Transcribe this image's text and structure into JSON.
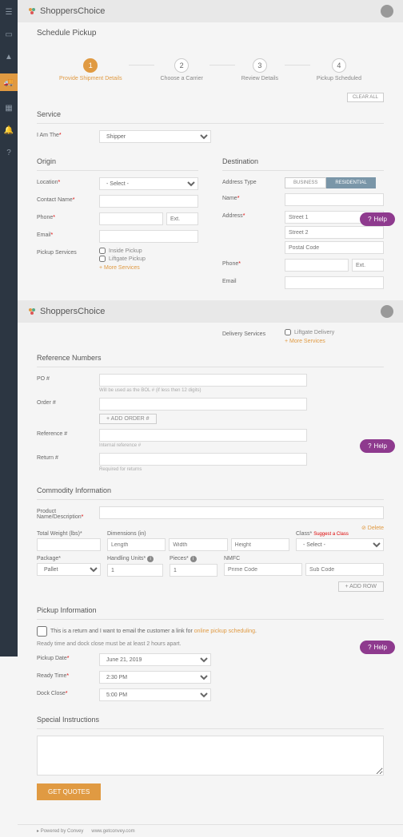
{
  "brand": "ShoppersChoice",
  "page_title": "Schedule Pickup",
  "steps": [
    {
      "num": "1",
      "label": "Provide Shipment Details"
    },
    {
      "num": "2",
      "label": "Choose a Carrier"
    },
    {
      "num": "3",
      "label": "Review Details"
    },
    {
      "num": "4",
      "label": "Pickup Scheduled"
    }
  ],
  "clear_all": "CLEAR ALL",
  "service": {
    "title": "Service",
    "i_am_the": "I Am The",
    "i_am_the_value": "Shipper"
  },
  "origin": {
    "title": "Origin",
    "location": "Location",
    "location_placeholder": "- Select -",
    "contact_name": "Contact Name",
    "phone": "Phone",
    "ext": "Ext.",
    "email": "Email",
    "pickup_services": "Pickup Services",
    "inside_pickup": "Inside Pickup",
    "liftgate_pickup": "Liftgate Pickup",
    "more": "+ More Services"
  },
  "destination": {
    "title": "Destination",
    "address_type": "Address Type",
    "business": "BUSINESS",
    "residential": "RESIDENTIAL",
    "name": "Name",
    "address": "Address",
    "street1": "Street 1",
    "street2": "Street 2",
    "postal": "Postal Code",
    "phone": "Phone",
    "ext": "Ext.",
    "email": "Email",
    "delivery_services": "Delivery Services",
    "liftgate_delivery": "Liftgate Delivery",
    "more": "+ More Services"
  },
  "ref": {
    "title": "Reference Numbers",
    "po": "PO #",
    "po_hint": "Will be used as the BOL # (if less then 12 digits)",
    "order": "Order #",
    "add_order": "ADD ORDER #",
    "reference": "Reference #",
    "ref_hint": "Internal reference #",
    "return": "Return #",
    "return_hint": "Required for returns"
  },
  "commodity": {
    "title": "Commodity Information",
    "product": "Product Name/Description",
    "delete": "Delete",
    "weight": "Total Weight (lbs)",
    "dimensions": "Dimensions (in)",
    "length": "Length",
    "width": "Width",
    "height": "Height",
    "class": "Class",
    "suggest": "Suggest a Class",
    "class_placeholder": "- Select -",
    "package": "Package",
    "package_value": "Pallet",
    "handling": "Handling Units",
    "handling_value": "1",
    "pieces": "Pieces",
    "pieces_value": "1",
    "nmfc": "NMFC",
    "prime": "Prime Code",
    "sub": "Sub Code",
    "add_row": "ADD ROW"
  },
  "pickup": {
    "title": "Pickup Information",
    "return_text": "This is a return and I want to email the customer a link for",
    "return_link": "online pickup scheduling",
    "note": "Ready time and dock close must be at least 2 hours apart.",
    "date": "Pickup Date",
    "date_value": "June 21, 2019",
    "ready": "Ready Time",
    "ready_value": "2:30 PM",
    "dock": "Dock Close",
    "dock_value": "5:00 PM"
  },
  "special": {
    "title": "Special Instructions"
  },
  "get_quotes": "GET QUOTES",
  "footer": {
    "powered": "Powered by Convey",
    "link": "www.getconvey.com"
  },
  "help": "Help"
}
